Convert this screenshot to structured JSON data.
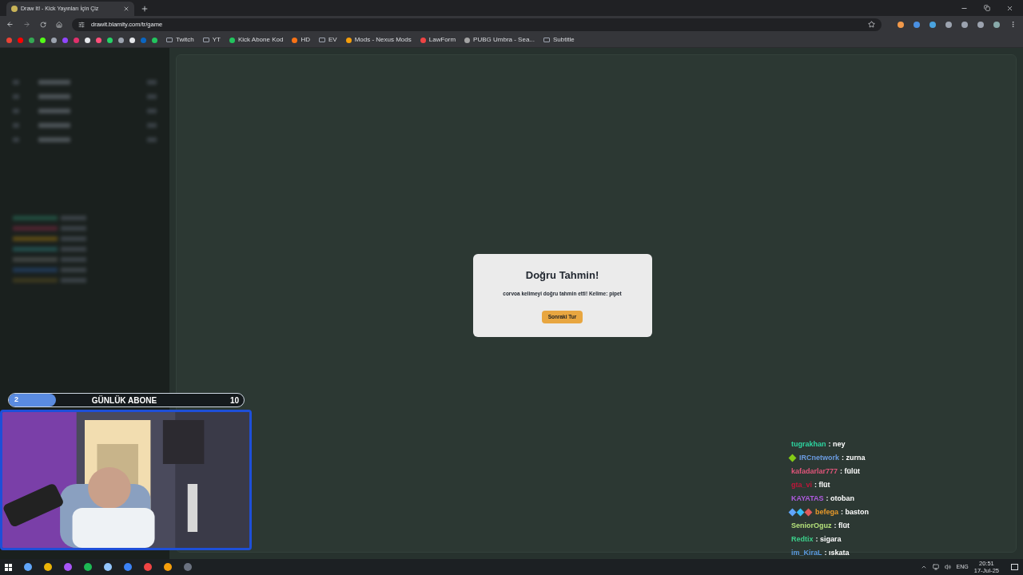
{
  "browser": {
    "tab": {
      "title": "Draw It! - Kick Yayınları İçin Çiz",
      "selected": true
    },
    "url": "drawit.blamity.com/tr/game",
    "bookmarks": [
      {
        "kind": "folder",
        "label": "Twitch",
        "color": "#9ca3af"
      },
      {
        "kind": "folder",
        "label": "YT",
        "color": "#9ca3af"
      },
      {
        "kind": "link",
        "label": "Kick Abone Kod",
        "color": "#22c55e"
      },
      {
        "kind": "link",
        "label": "HD",
        "color": "#f97316"
      },
      {
        "kind": "folder",
        "label": "EV",
        "color": "#9ca3af"
      },
      {
        "kind": "link",
        "label": "Mods - Nexus Mods",
        "color": "#f59e0b"
      },
      {
        "kind": "link",
        "label": "LawForm",
        "color": "#ef4444"
      },
      {
        "kind": "link",
        "label": "PUBG Umbra - Sea...",
        "color": "#a3a3a3"
      },
      {
        "kind": "folder",
        "label": "Subtitle",
        "color": "#9ca3af"
      }
    ]
  },
  "dialog": {
    "title": "Doğru Tahmin!",
    "message": "corvoa kelimeyi doğru tahmin etti! Kelime: pipet",
    "button": "Sonraki Tur"
  },
  "sub_goal": {
    "current": "2",
    "label": "GÜNLÜK ABONE",
    "target": "10",
    "level": 0.2
  },
  "chat": [
    {
      "user": "tugrakhan",
      "color": "#2dd4a0",
      "message": ": ney"
    },
    {
      "user": "IRCnetwork",
      "color": "#6b9be0",
      "message": ": zurna",
      "badges": [
        {
          "color": "#84cc16"
        }
      ]
    },
    {
      "user": "kafadarlar777",
      "color": "#e0557a",
      "message": ": fülüt"
    },
    {
      "user": "gta_vi",
      "color": "#c0163a",
      "message": ": flüt"
    },
    {
      "user": "KAYATAS",
      "color": "#b05be0",
      "message": ": otoban"
    },
    {
      "user": "befega",
      "color": "#e89a2a",
      "message": ": baston",
      "badges": [
        {
          "color": "#60a5fa"
        },
        {
          "color": "#38bdf8"
        },
        {
          "color": "#e05a5a"
        }
      ]
    },
    {
      "user": "SeniorOguz",
      "color": "#b4e07a",
      "message": ": flüt"
    },
    {
      "user": "Redtix",
      "color": "#3ccf8a",
      "message": ": sigara"
    },
    {
      "user": "im_KiraL",
      "color": "#5b9be0",
      "message": ": ıskata"
    }
  ],
  "taskbar": {
    "language": "ENG",
    "time": "20:51",
    "date": "17-Jul-25"
  }
}
